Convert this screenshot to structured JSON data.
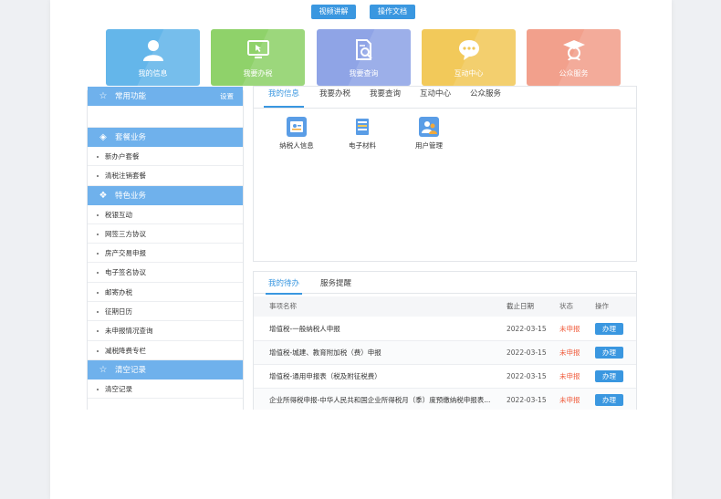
{
  "top_buttons": [
    {
      "label": "视频讲解"
    },
    {
      "label": "操作文档"
    }
  ],
  "tiles": [
    {
      "label": "我的信息",
      "icon": "user-icon",
      "color": "#64b6ea"
    },
    {
      "label": "我要办税",
      "icon": "monitor-icon",
      "color": "#8fd26a"
    },
    {
      "label": "我要查询",
      "icon": "document-search-icon",
      "color": "#8fa4e6"
    },
    {
      "label": "互动中心",
      "icon": "chat-icon",
      "color": "#f2c95a"
    },
    {
      "label": "公众服务",
      "icon": "graduate-icon",
      "color": "#f2a08c"
    }
  ],
  "sidebar": {
    "common": {
      "title": "常用功能",
      "setting": "设置"
    },
    "package": {
      "title": "套餐业务",
      "items": [
        "新办户套餐",
        "清税注销套餐"
      ]
    },
    "special": {
      "title": "特色业务",
      "items": [
        "税银互动",
        "网签三方协议",
        "房产交易申报",
        "电子签名协议",
        "邮寄办税",
        "征期日历",
        "未申报情况查询",
        "减税降费专栏"
      ]
    },
    "clear": {
      "title": "清空记录",
      "items": [
        "清空记录"
      ]
    }
  },
  "info_panel": {
    "tabs": [
      "我的信息",
      "我要办税",
      "我要查询",
      "互动中心",
      "公众服务"
    ],
    "services": [
      {
        "label": "纳税人信息",
        "icon": "id-card-icon"
      },
      {
        "label": "电子材料",
        "icon": "files-icon"
      },
      {
        "label": "用户管理",
        "icon": "users-icon"
      }
    ]
  },
  "todo_panel": {
    "tabs": [
      "我的待办",
      "服务提醒"
    ],
    "columns": [
      "事项名称",
      "截止日期",
      "状态",
      "操作"
    ],
    "rows": [
      {
        "name": "增值税-一般纳税人申报",
        "date": "2022-03-15",
        "status": "未申报",
        "action": "办理"
      },
      {
        "name": "增值税-城建、教育附加税（费）申报",
        "date": "2022-03-15",
        "status": "未申报",
        "action": "办理"
      },
      {
        "name": "增值税-通用申报表（税及附征税费）",
        "date": "2022-03-15",
        "status": "未申报",
        "action": "办理"
      },
      {
        "name": "企业所得税申报-中华人民共和国企业所得税月（季）度预缴纳税申报表...",
        "date": "2022-03-15",
        "status": "未申报",
        "action": "办理"
      }
    ]
  }
}
